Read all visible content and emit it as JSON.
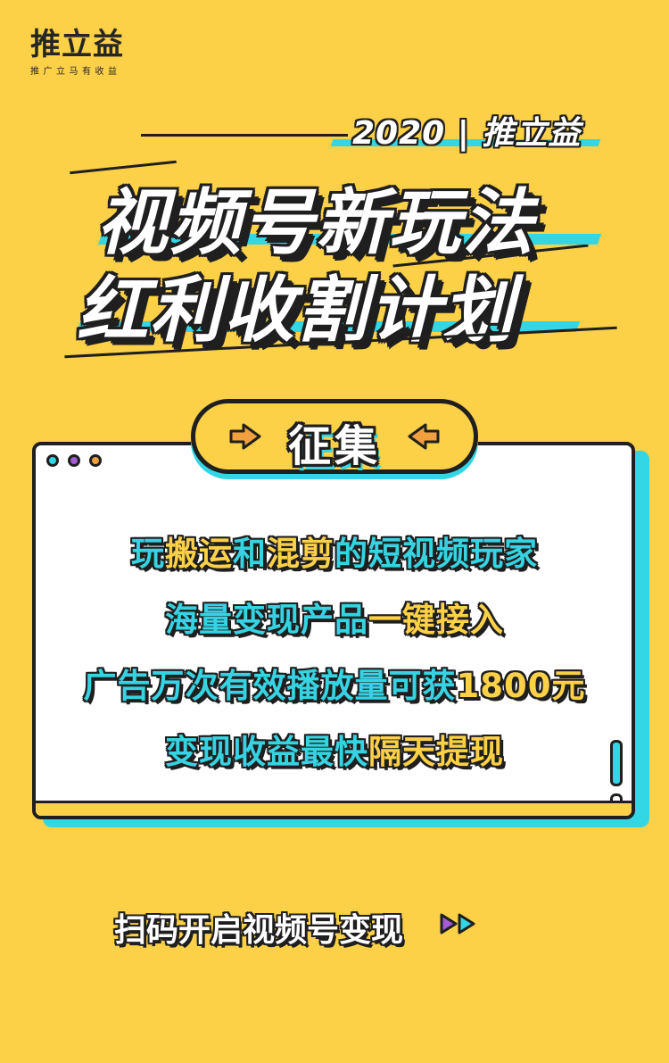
{
  "logo": {
    "name": "推立益",
    "tagline": "推广立马有收益"
  },
  "header": {
    "year_label": "2020 | 推立益",
    "headline_line1": "视频号新玩法",
    "headline_line2": "红利收割计划"
  },
  "badge": {
    "label": "征集"
  },
  "card": {
    "lines": [
      [
        {
          "text": "玩",
          "color": "cyan"
        },
        {
          "text": "搬运",
          "color": "yellow"
        },
        {
          "text": "和",
          "color": "cyan"
        },
        {
          "text": "混剪",
          "color": "yellow"
        },
        {
          "text": "的短视频玩家",
          "color": "cyan"
        }
      ],
      [
        {
          "text": "海量变现产品",
          "color": "cyan"
        },
        {
          "text": "一键接入",
          "color": "yellow"
        }
      ],
      [
        {
          "text": "广告万次有效播放量可获",
          "color": "cyan"
        },
        {
          "text": "1800元",
          "color": "yellow"
        }
      ],
      [
        {
          "text": "变现收益最快",
          "color": "cyan"
        },
        {
          "text": "隔天提现",
          "color": "yellow"
        }
      ]
    ],
    "window_dots": [
      "#33d6e4",
      "#a35bd6",
      "#f2a03d"
    ]
  },
  "cta": {
    "label": "扫码开启视频号变现"
  },
  "colors": {
    "background": "#fcd047",
    "accent_cyan": "#33d6e4",
    "ink": "#1f1f1f"
  }
}
